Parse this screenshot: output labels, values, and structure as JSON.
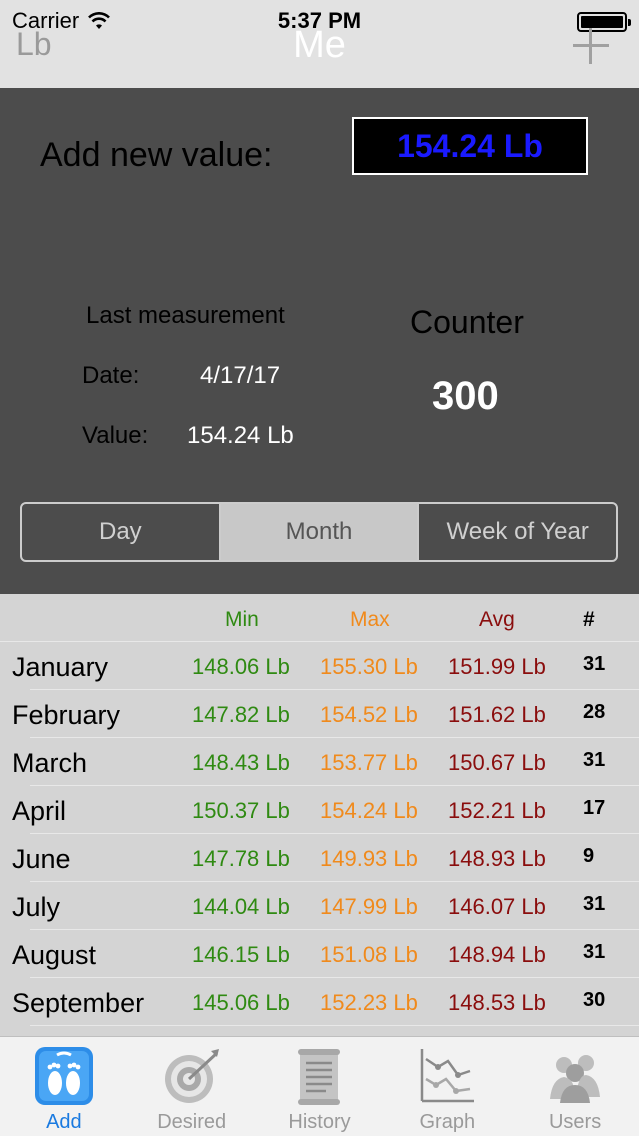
{
  "status": {
    "carrier": "Carrier",
    "time": "5:37 PM"
  },
  "nav": {
    "unit": "Lb",
    "title": "Me"
  },
  "add": {
    "label": "Add new value:",
    "value": "154.24 Lb"
  },
  "last": {
    "title": "Last measurement",
    "date_label": "Date:",
    "date_value": "4/17/17",
    "value_label": "Value:",
    "value_value": "154.24 Lb"
  },
  "counter": {
    "label": "Counter",
    "value": "300"
  },
  "segments": [
    {
      "label": "Day"
    },
    {
      "label": "Month"
    },
    {
      "label": "Week of Year"
    }
  ],
  "table": {
    "headers": {
      "min": "Min",
      "max": "Max",
      "avg": "Avg",
      "count": "#"
    },
    "rows": [
      {
        "month": "January",
        "min": "148.06 Lb",
        "max": "155.30 Lb",
        "avg": "151.99 Lb",
        "count": "31"
      },
      {
        "month": "February",
        "min": "147.82 Lb",
        "max": "154.52 Lb",
        "avg": "151.62 Lb",
        "count": "28"
      },
      {
        "month": "March",
        "min": "148.43 Lb",
        "max": "153.77 Lb",
        "avg": "150.67 Lb",
        "count": "31"
      },
      {
        "month": "April",
        "min": "150.37 Lb",
        "max": "154.24 Lb",
        "avg": "152.21 Lb",
        "count": "17"
      },
      {
        "month": "June",
        "min": "147.78 Lb",
        "max": "149.93 Lb",
        "avg": "148.93 Lb",
        "count": "9"
      },
      {
        "month": "July",
        "min": "144.04 Lb",
        "max": "147.99 Lb",
        "avg": "146.07 Lb",
        "count": "31"
      },
      {
        "month": "August",
        "min": "146.15 Lb",
        "max": "151.08 Lb",
        "avg": "148.94 Lb",
        "count": "31"
      },
      {
        "month": "September",
        "min": "145.06 Lb",
        "max": "152.23 Lb",
        "avg": "148.53 Lb",
        "count": "30"
      }
    ]
  },
  "tabs": [
    {
      "label": "Add",
      "icon": "footprints-scale-icon"
    },
    {
      "label": "Desired",
      "icon": "target-icon"
    },
    {
      "label": "History",
      "icon": "scroll-icon"
    },
    {
      "label": "Graph",
      "icon": "graph-icon"
    },
    {
      "label": "Users",
      "icon": "users-icon"
    }
  ],
  "colors": {
    "min": "#2f8a12",
    "max": "#f08a1c",
    "avg": "#8a0d0d",
    "value_text": "#1a1aff",
    "active_tab": "#1a7ae0"
  }
}
